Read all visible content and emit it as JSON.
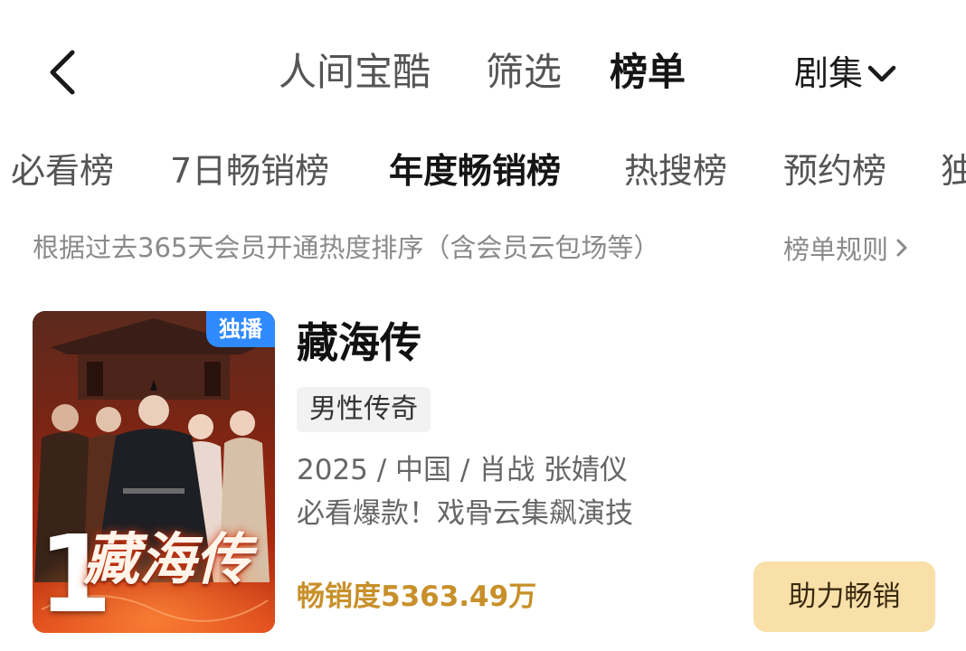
{
  "nav": {
    "tabs": [
      "人间宝酷",
      "筛选",
      "榜单"
    ],
    "active_tab": "榜单",
    "category": "剧集"
  },
  "ranking_tabs": [
    "必看榜",
    "7日畅销榜",
    "年度畅销榜",
    "热搜榜",
    "预约榜",
    "独"
  ],
  "active_ranking_tab": "年度畅销榜",
  "rule": {
    "description": "根据过去365天会员开通热度排序（含会员云包场等）",
    "link": "榜单规则"
  },
  "item": {
    "rank": "1",
    "badge": "独播",
    "poster_title": "藏海传",
    "title": "藏海传",
    "tag": "男性传奇",
    "meta": "2025 / 中国 / 肖战 张婧仪",
    "slogan": "必看爆款！戏骨云集飙演技",
    "sales": "畅销度5363.49万",
    "button": "助力畅销"
  },
  "colors": {
    "accent_gold": "#c8902a",
    "button_bg": "#f8e0a8",
    "badge_blue": "#2f8bff"
  }
}
